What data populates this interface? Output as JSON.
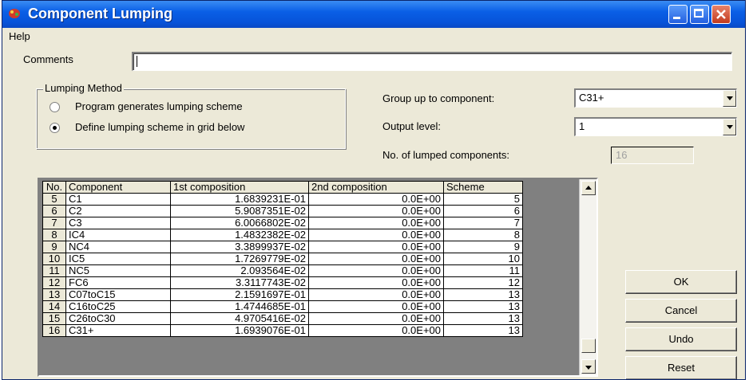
{
  "window": {
    "title": "Component Lumping"
  },
  "menu": {
    "help": "Help"
  },
  "comments": {
    "label": "Comments",
    "value": ""
  },
  "lumping_method": {
    "legend": "Lumping Method",
    "options": [
      {
        "label": "Program generates lumping scheme",
        "selected": false
      },
      {
        "label": "Define lumping scheme in grid below",
        "selected": true
      }
    ]
  },
  "group_up": {
    "label": "Group up to component:",
    "value": "C31+"
  },
  "output_level": {
    "label": "Output level:",
    "value": "1"
  },
  "lumped": {
    "label": "No. of lumped components:",
    "value": "16"
  },
  "grid": {
    "headers": [
      "No.",
      "Component",
      "1st composition",
      "2nd composition",
      "Scheme"
    ],
    "rows": [
      [
        "5",
        "C1",
        "1.6839231E-01",
        "0.0E+00",
        "5"
      ],
      [
        "6",
        "C2",
        "5.9087351E-02",
        "0.0E+00",
        "6"
      ],
      [
        "7",
        "C3",
        "6.0066802E-02",
        "0.0E+00",
        "7"
      ],
      [
        "8",
        "IC4",
        "1.4832382E-02",
        "0.0E+00",
        "8"
      ],
      [
        "9",
        "NC4",
        "3.3899937E-02",
        "0.0E+00",
        "9"
      ],
      [
        "10",
        "IC5",
        "1.7269779E-02",
        "0.0E+00",
        "10"
      ],
      [
        "11",
        "NC5",
        "2.093564E-02",
        "0.0E+00",
        "11"
      ],
      [
        "12",
        "FC6",
        "3.3117743E-02",
        "0.0E+00",
        "12"
      ],
      [
        "13",
        "C07toC15",
        "2.1591697E-01",
        "0.0E+00",
        "13"
      ],
      [
        "14",
        "C16toC25",
        "1.4744685E-01",
        "0.0E+00",
        "13"
      ],
      [
        "15",
        "C26toC30",
        "4.9705416E-02",
        "0.0E+00",
        "13"
      ],
      [
        "16",
        "C31+",
        "1.6939076E-01",
        "0.0E+00",
        "13"
      ]
    ]
  },
  "buttons": {
    "ok": "OK",
    "cancel": "Cancel",
    "undo": "Undo",
    "reset": "Reset"
  },
  "colors": {
    "title_bar": "#0a5fe6",
    "face": "#ece9d8",
    "close": "#c23a1e"
  }
}
